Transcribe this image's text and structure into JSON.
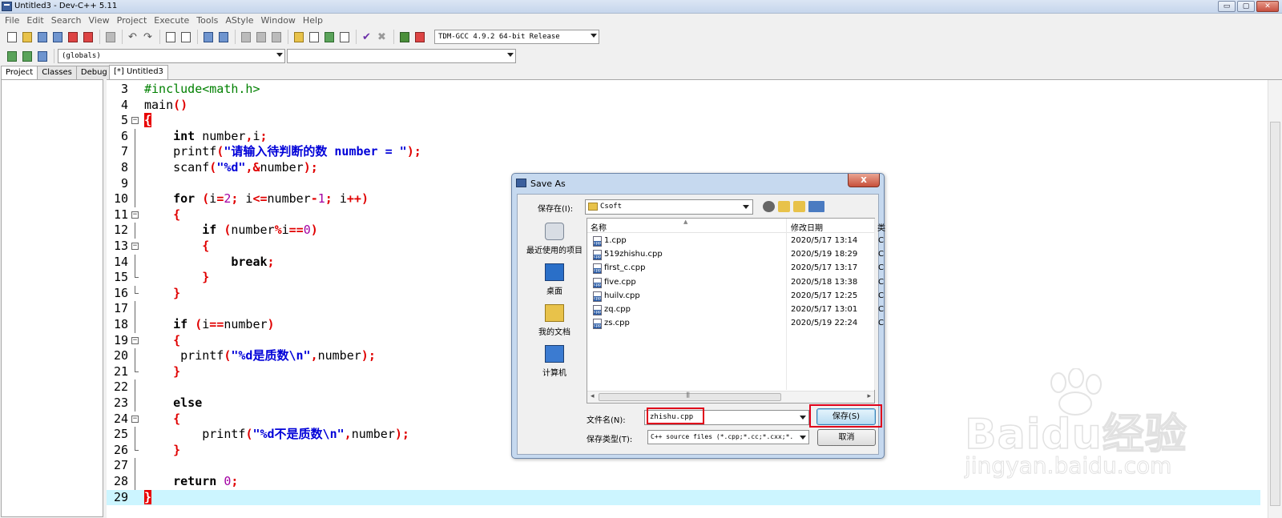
{
  "window": {
    "title": "Untitled3 - Dev-C++ 5.11",
    "buttons": {
      "minimize": "▭",
      "maximize": "▢",
      "close": "✕"
    }
  },
  "menu": [
    "File",
    "Edit",
    "Search",
    "View",
    "Project",
    "Execute",
    "Tools",
    "AStyle",
    "Window",
    "Help"
  ],
  "toolbar": {
    "compiler": "TDM-GCC 4.9.2 64-bit Release",
    "scope": "(globals)",
    "symbol": ""
  },
  "left_panel": {
    "tabs": [
      "Project",
      "Classes",
      "Debug"
    ],
    "active_tab": "Project"
  },
  "editor": {
    "tab_label": "[*] Untitled3",
    "lines": [
      {
        "num": "3",
        "text": "#include<math.h>"
      },
      {
        "num": "4",
        "text": "main()"
      },
      {
        "num": "5",
        "text": "{"
      },
      {
        "num": "6",
        "text": "    int number,i;"
      },
      {
        "num": "7",
        "text": "    printf(\"请输入待判断的数 number = \");"
      },
      {
        "num": "8",
        "text": "    scanf(\"%d\",&number);"
      },
      {
        "num": "9",
        "text": ""
      },
      {
        "num": "10",
        "text": "    for (i=2; i<=number-1; i++)"
      },
      {
        "num": "11",
        "text": "    {"
      },
      {
        "num": "12",
        "text": "        if (number%i==0)"
      },
      {
        "num": "13",
        "text": "        {"
      },
      {
        "num": "14",
        "text": "            break;"
      },
      {
        "num": "15",
        "text": "        }"
      },
      {
        "num": "16",
        "text": "    }"
      },
      {
        "num": "17",
        "text": ""
      },
      {
        "num": "18",
        "text": "    if (i==number)"
      },
      {
        "num": "19",
        "text": "    {"
      },
      {
        "num": "20",
        "text": "     printf(\"%d是质数\\n\",number);"
      },
      {
        "num": "21",
        "text": "    }"
      },
      {
        "num": "22",
        "text": ""
      },
      {
        "num": "23",
        "text": "    else"
      },
      {
        "num": "24",
        "text": "    {"
      },
      {
        "num": "25",
        "text": "        printf(\"%d不是质数\\n\",number);"
      },
      {
        "num": "26",
        "text": "    }"
      },
      {
        "num": "27",
        "text": ""
      },
      {
        "num": "28",
        "text": "    return 0;"
      },
      {
        "num": "29",
        "text": "}"
      }
    ]
  },
  "dialog": {
    "title": "Save As",
    "close_label": "x",
    "save_in_label": "保存在(I):",
    "save_in_value": "Csoft",
    "places": [
      {
        "label": "最近使用的项目",
        "icon": "recent-places-icon"
      },
      {
        "label": "桌面",
        "icon": "desktop-icon"
      },
      {
        "label": "我的文档",
        "icon": "documents-icon"
      },
      {
        "label": "计算机",
        "icon": "computer-icon"
      }
    ],
    "columns": [
      "名称",
      "修改日期",
      "类"
    ],
    "files": [
      {
        "name": "1.cpp",
        "date": "2020/5/17 13:14",
        "extra": "C"
      },
      {
        "name": "519zhishu.cpp",
        "date": "2020/5/19 18:29",
        "extra": "C"
      },
      {
        "name": "first_c.cpp",
        "date": "2020/5/17 13:17",
        "extra": "C"
      },
      {
        "name": "five.cpp",
        "date": "2020/5/18 13:38",
        "extra": "C"
      },
      {
        "name": "huilv.cpp",
        "date": "2020/5/17 12:25",
        "extra": "C"
      },
      {
        "name": "zq.cpp",
        "date": "2020/5/17 13:01",
        "extra": "C"
      },
      {
        "name": "zs.cpp",
        "date": "2020/5/19 22:24",
        "extra": "C"
      }
    ],
    "file_name_label": "文件名(N):",
    "file_name_value": "zhishu.cpp",
    "file_type_label": "保存类型(T):",
    "file_type_value": "C++ source files (*.cpp;*.cc;*.cxx;*.",
    "save_button": "保存(S)",
    "cancel_button": "取消"
  },
  "watermark": {
    "brand": "Baidu经验",
    "url": "jingyan.baidu.com"
  },
  "colors": {
    "keyword": "#000000",
    "preprocessor": "#008000",
    "string": "#0000d8",
    "number": "#a300a3",
    "symbol": "#e00000",
    "current_line": "#ccf5ff",
    "highlight_box": "#e0001a"
  }
}
